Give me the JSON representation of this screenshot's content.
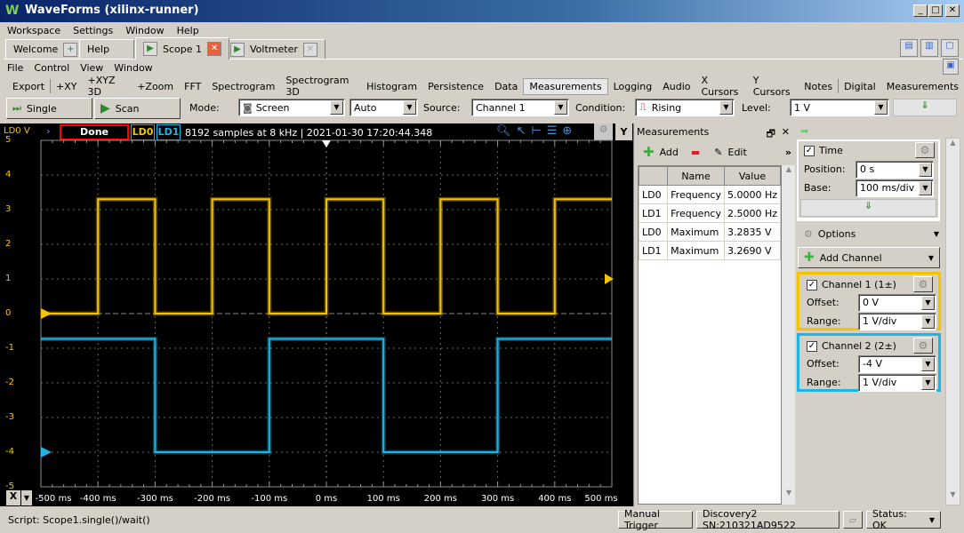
{
  "window": {
    "title": "WaveForms (xilinx-runner)",
    "logo": "W"
  },
  "main_menu": [
    "Workspace",
    "Settings",
    "Window",
    "Help"
  ],
  "tabs": [
    {
      "label": "Welcome"
    },
    {
      "label": "Help"
    },
    {
      "label": "Scope 1",
      "active": true
    },
    {
      "label": "Voltmeter"
    }
  ],
  "scope_menu": [
    "File",
    "Control",
    "View",
    "Window"
  ],
  "toolbar": [
    "Export",
    "+XY",
    "+XYZ 3D",
    "+Zoom",
    "FFT",
    "Spectrogram",
    "Spectrogram 3D",
    "Histogram",
    "Persistence",
    "Data",
    "Measurements",
    "Logging",
    "Audio",
    "X Cursors",
    "Y Cursors",
    "Notes",
    "Digital",
    "Measurements"
  ],
  "controls": {
    "single": "Single",
    "scan": "Scan",
    "mode_label": "Mode:",
    "mode": "Screen",
    "auto": "Auto",
    "source_label": "Source:",
    "source": "Channel 1",
    "condition_label": "Condition:",
    "condition": "Rising",
    "level_label": "Level:",
    "level": "1 V"
  },
  "plot_header": {
    "axis_label": "LD0 V",
    "status": "Done",
    "ch0": "LD0",
    "ch1": "LD1",
    "info": "8192 samples at 8 kHz | 2021-01-30 17:20:44.348",
    "y_button": "Y",
    "x_button": "X"
  },
  "colors": {
    "ld0": "#f5c400",
    "ld1": "#1eb4e6",
    "status_border": "#ff0000"
  },
  "measurements": {
    "title": "Measurements",
    "add": "Add",
    "edit": "Edit",
    "headers": [
      "Name",
      "Value"
    ],
    "rows": [
      [
        "LD0",
        "Frequency",
        "5.0000 Hz"
      ],
      [
        "LD1",
        "Frequency",
        "2.5000 Hz"
      ],
      [
        "LD0",
        "Maximum",
        "3.2835 V"
      ],
      [
        "LD1",
        "Maximum",
        "3.2690 V"
      ]
    ]
  },
  "time": {
    "label": "Time",
    "position_label": "Position:",
    "position": "0 s",
    "base_label": "Base:",
    "base": "100 ms/div"
  },
  "options": "Options",
  "add_channel": "Add Channel",
  "channels": [
    {
      "label": "Channel 1 (1±)",
      "offset_label": "Offset:",
      "offset": "0 V",
      "range_label": "Range:",
      "range": "1 V/div"
    },
    {
      "label": "Channel 2 (2±)",
      "offset_label": "Offset:",
      "offset": "-4 V",
      "range_label": "Range:",
      "range": "1 V/div"
    }
  ],
  "statusbar": {
    "script": "Script: Scope1.single()/wait()",
    "manual_trigger": "Manual Trigger",
    "device": "Discovery2 SN:210321AD9522",
    "status": "Status: OK"
  },
  "chart_data": {
    "type": "line",
    "xlim": [
      -500,
      500
    ],
    "ylim": [
      -5,
      5
    ],
    "grid": true,
    "xticks": [
      "-500 ms",
      "-400 ms",
      "-300 ms",
      "-200 ms",
      "-100 ms",
      "0 ms",
      "100 ms",
      "200 ms",
      "300 ms",
      "400 ms",
      "500 ms"
    ],
    "yticks": [
      "5",
      "4",
      "3",
      "2",
      "1",
      "0",
      "-1",
      "-2",
      "-3",
      "-4",
      "-5"
    ],
    "series": [
      {
        "name": "LD0",
        "color": "#f5c400",
        "x": [
          -500,
          -400,
          -400,
          -300,
          -300,
          -200,
          -200,
          -100,
          -100,
          0,
          0,
          100,
          100,
          200,
          200,
          300,
          300,
          400,
          400,
          500
        ],
        "y": [
          0,
          0,
          3.3,
          3.3,
          0,
          0,
          3.3,
          3.3,
          0,
          0,
          3.3,
          3.3,
          0,
          0,
          3.3,
          3.3,
          0,
          0,
          3.3,
          3.3
        ]
      },
      {
        "name": "LD1",
        "color": "#1eb4e6",
        "x": [
          -500,
          -300,
          -300,
          -100,
          -100,
          100,
          100,
          300,
          300,
          500
        ],
        "y": [
          -0.73,
          -0.73,
          -4.0,
          -4.0,
          -0.73,
          -0.73,
          -4.0,
          -4.0,
          -0.73,
          -0.73
        ]
      }
    ]
  }
}
